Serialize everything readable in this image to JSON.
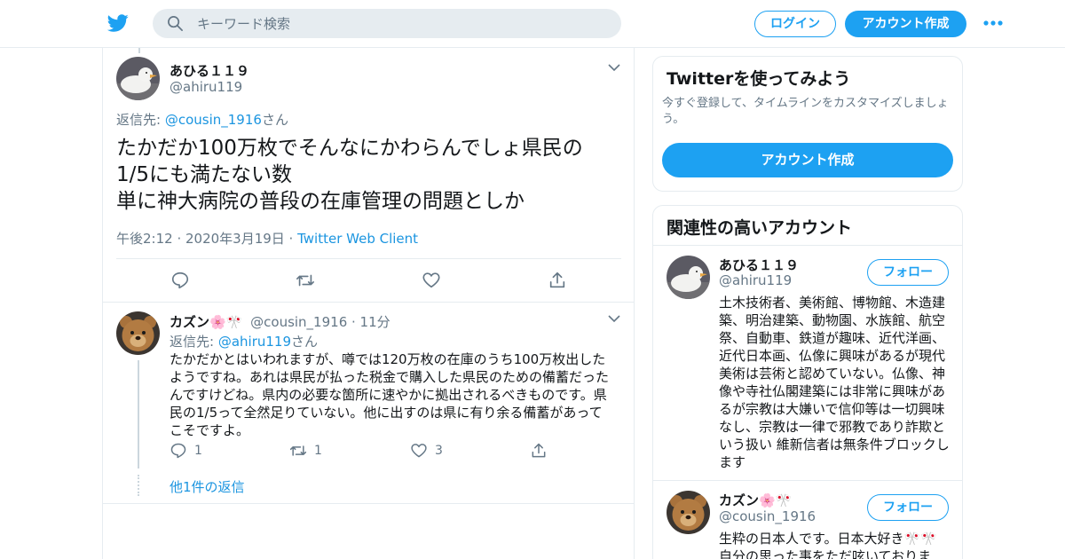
{
  "header": {
    "search_placeholder": "キーワード検索",
    "login_label": "ログイン",
    "signup_label": "アカウント作成"
  },
  "tweet": {
    "name": "あひる１１９",
    "handle": "@ahiru119",
    "reply_prefix": "返信先: ",
    "reply_to": "@cousin_1916",
    "reply_suffix": "さん",
    "text": "たかだか100万枚でそんなにかわらんでしょ県民の\n1/5にも満たない数\n単に神大病院の普段の在庫管理の問題としか",
    "time": "午後2:12 · 2020年3月19日 · ",
    "source": "Twitter Web Client"
  },
  "reply": {
    "name": "カズン🌸🎌",
    "handle": "@cousin_1916",
    "time": " · 11分",
    "reply_prefix": "返信先: ",
    "reply_to": "@ahiru119",
    "reply_suffix": "さん",
    "text": "たかだかとはいわれますが、噂では120万枚の在庫のうち100万枚出したようですね。あれは県民が払った税金で購入した県民のための備蓄だったんですけどね。県内の必要な箇所に速やかに拠出されるべきものです。県民の1/5って全然足りていない。他に出すのは県に有り余る備蓄があってこそですよ。",
    "reply_count": "1",
    "retweet_count": "1",
    "like_count": "3",
    "more_replies": "他1件の返信"
  },
  "sidebar": {
    "try_title": "Twitterを使ってみよう",
    "try_desc": "今すぐ登録して、タイムラインをカスタマイズしましょう。",
    "try_button": "アカウント作成",
    "related_title": "関連性の高いアカウント",
    "follow_label": "フォロー",
    "accounts": [
      {
        "name": "あひる１１９",
        "handle": "@ahiru119",
        "bio": "土木技術者、美術館、博物館、木造建築、明治建築、動物園、水族館、航空祭、自動車、鉄道が趣味、近代洋画、近代日本画、仏像に興味があるが現代美術は芸術と認めていない。仏像、神像や寺社仏閣建築には非常に興味があるが宗教は大嫌いで信仰等は一切興味なし、宗教は一律で邪教であり詐欺という扱い 維新信者は無条件ブロックします"
      },
      {
        "name": "カズン🌸🎌",
        "handle": "@cousin_1916",
        "bio": "生粋の日本人です。日本大好き🎌🎌 自分の思った事をただ呟いております。"
      }
    ]
  },
  "colors": {
    "accent": "#1da1f2",
    "link": "#1b95e0",
    "muted": "#657786",
    "border": "#e6ecf0"
  }
}
